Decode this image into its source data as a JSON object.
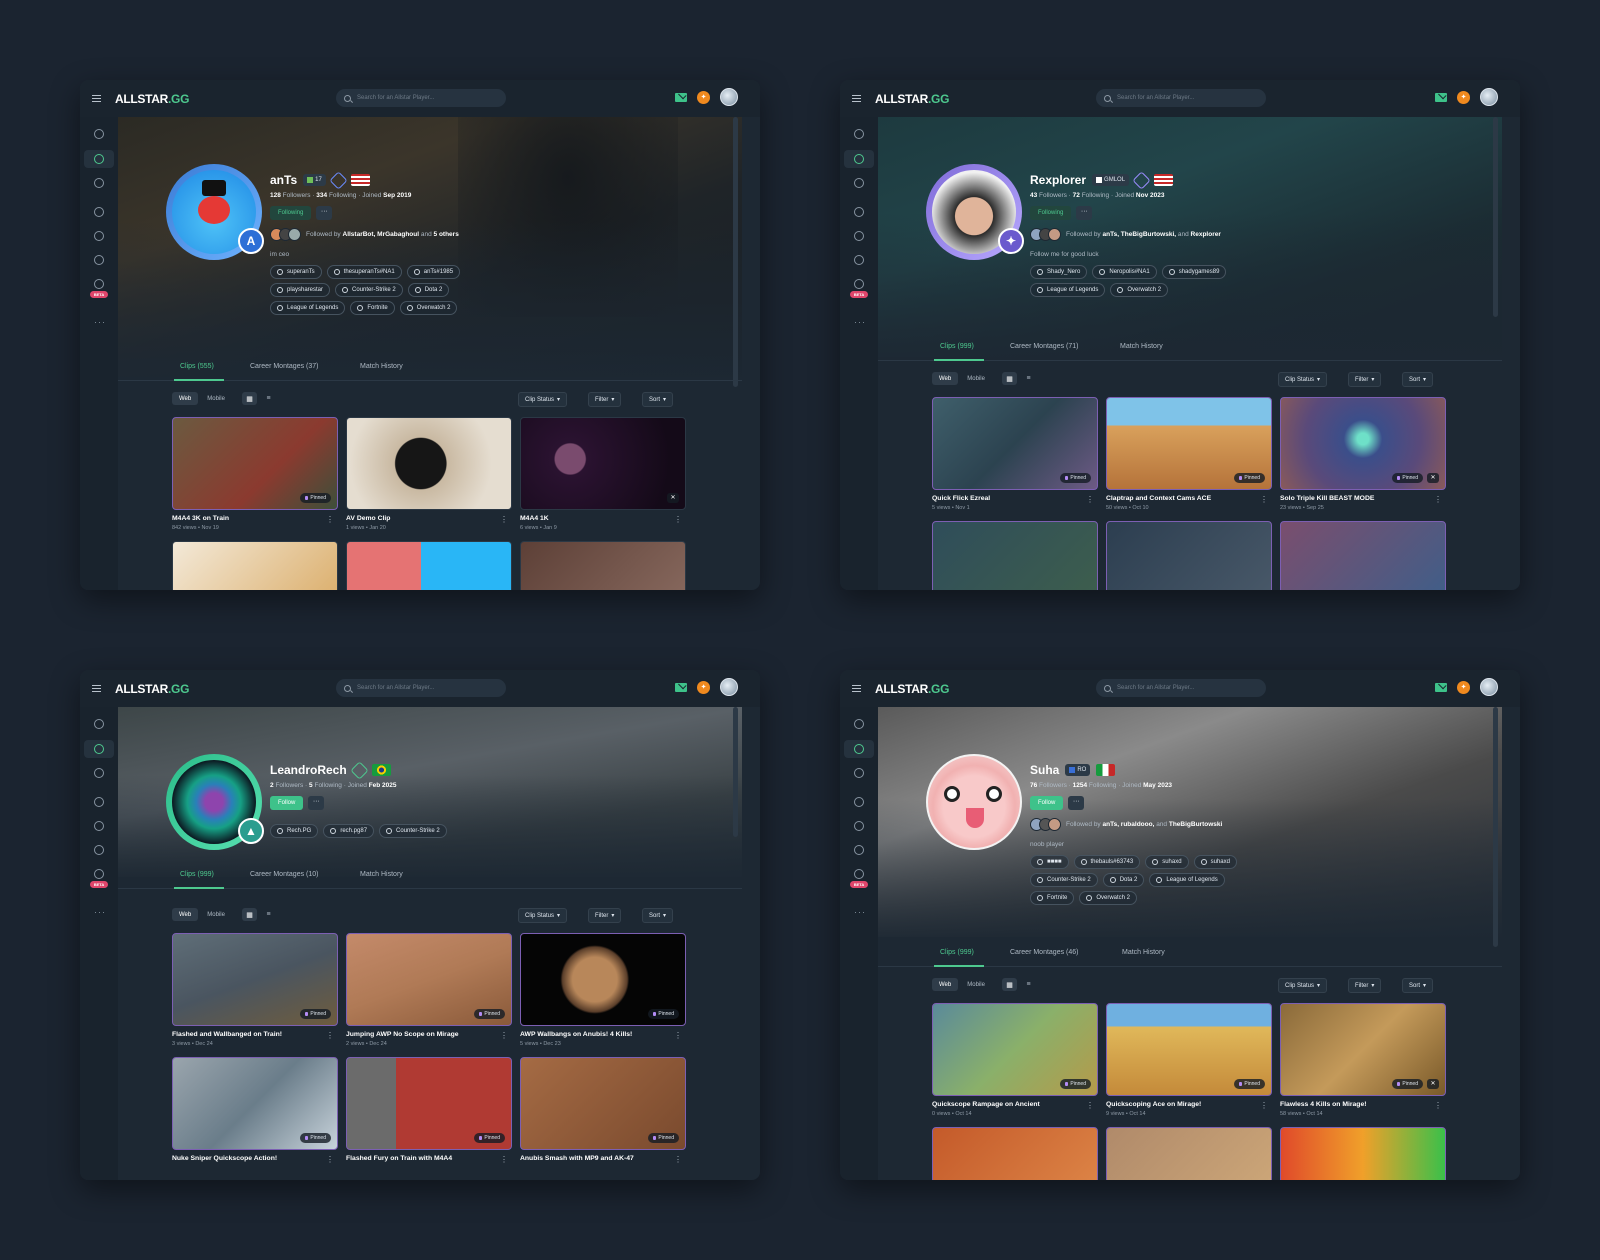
{
  "app": {
    "logo_main": "ALLSTAR",
    "logo_suffix": ".GG",
    "search_placeholder": "Search for an Allstar Player...",
    "beta_label": "BETA",
    "more_glyph": "···",
    "coin_glyph": "✦"
  },
  "common": {
    "web": "Web",
    "mobile": "Mobile",
    "clip_status": "Clip Status",
    "filter": "Filter",
    "sort": "Sort",
    "pinned": "Pinned",
    "more_button": "···",
    "kebab": "⋮",
    "followed_by_prefix": "Followed by",
    "followers_label": "Followers",
    "following_label": "Following",
    "joined_label": "Joined",
    "tab_montages_label": "Career Montages",
    "tab_match_label": "Match History"
  },
  "colors": {
    "accent": "#4ec98f",
    "background": "#1b2430",
    "panel": "#1d2833",
    "pinned_border": "#7c5fb3",
    "coin": "#f08a1f",
    "beta": "#e0456b"
  },
  "profiles": [
    {
      "name": "anTs",
      "level_badge": "17",
      "followers": "128",
      "following": "334",
      "joined": "Sep 2019",
      "follow_button": "Following",
      "followed_by_names": "AllstarBot, MrGabaghoul",
      "followed_by_tail": "5 others",
      "bio": "im ceo",
      "socials": [
        "superanTs",
        "thesuperanTs#NA1",
        "anTs#1985",
        "playsharestar",
        "Counter-Strike 2",
        "Dota 2",
        "League of Legends",
        "Fortnite",
        "Overwatch 2"
      ],
      "tab_clips": "Clips (555)",
      "tab_montages": "Career Montages (37)",
      "tab_match": "Match History",
      "clips": [
        {
          "title": "M4A4 3K on Train",
          "meta": "842 views • Nov 19"
        },
        {
          "title": "AV Demo Clip",
          "meta": "1 views • Jan 20"
        },
        {
          "title": "M4A4 1K",
          "meta": "6 views • Jan 9"
        }
      ]
    },
    {
      "name": "Rexplorer",
      "level_badge": "GMLOL",
      "followers": "43",
      "following": "72",
      "joined": "Nov 2023",
      "follow_button": "Following",
      "followed_by_names": "anTs, TheBigBurtowski,",
      "followed_by_tail": "Rexplorer",
      "bio": "Follow me for good luck",
      "socials": [
        "Shady_Nero",
        "Neropolis#NA1",
        "shadygames89",
        "League of Legends",
        "Overwatch 2"
      ],
      "tab_clips": "Clips (999)",
      "tab_montages": "Career Montages (71)",
      "tab_match": "Match History",
      "clips": [
        {
          "title": "Quick Flick Ezreal",
          "meta": "5 views • Nov 1"
        },
        {
          "title": "Claptrap and Context Cams ACE",
          "meta": "50 views • Oct 10"
        },
        {
          "title": "Solo Triple Kill BEAST MODE",
          "meta": "23 views • Sep 25"
        }
      ]
    },
    {
      "name": "LeandroRech",
      "level_badge": "",
      "followers": "2",
      "following": "5",
      "joined": "Feb 2025",
      "follow_button": "Follow",
      "followed_by_names": "",
      "followed_by_tail": "",
      "bio": "",
      "socials": [
        "Rech.PG",
        "rech.pg87",
        "Counter-Strike 2"
      ],
      "tab_clips": "Clips (999)",
      "tab_montages": "Career Montages (10)",
      "tab_match": "Match History",
      "clips": [
        {
          "title": "Flashed and Wallbanged on Train!",
          "meta": "3 views • Dec 24"
        },
        {
          "title": "Jumping AWP No Scope on Mirage",
          "meta": "2 views • Dec 24"
        },
        {
          "title": "AWP Wallbangs on Anubis! 4 Kills!",
          "meta": "5 views • Dec 23"
        },
        {
          "title": "Nuke Sniper Quickscope Action!",
          "meta": ""
        },
        {
          "title": "Flashed Fury on Train with M4A4",
          "meta": ""
        },
        {
          "title": "Anubis Smash with MP9 and AK-47",
          "meta": ""
        }
      ]
    },
    {
      "name": "Suha",
      "level_badge": "RO",
      "followers": "76",
      "following": "1254",
      "joined": "May 2023",
      "follow_button": "Follow",
      "followed_by_names": "anTs, rubaldooo,",
      "followed_by_tail": "TheBigBurtowski",
      "bio": "noob player",
      "socials": [
        "■■■■",
        "thebauls#63743",
        "suhaxd",
        "suhaxd",
        "Counter-Strike 2",
        "Dota 2",
        "League of Legends",
        "Fortnite",
        "Overwatch 2"
      ],
      "tab_clips": "Clips (999)",
      "tab_montages": "Career Montages (46)",
      "tab_match": "Match History",
      "clips": [
        {
          "title": "Quickscope Rampage on Ancient",
          "meta": "0 views • Oct 14"
        },
        {
          "title": "Quickscoping Ace on Mirage!",
          "meta": "9 views • Oct 14"
        },
        {
          "title": "Flawless 4 Kills on Mirage!",
          "meta": "58 views • Oct 14"
        }
      ]
    }
  ]
}
